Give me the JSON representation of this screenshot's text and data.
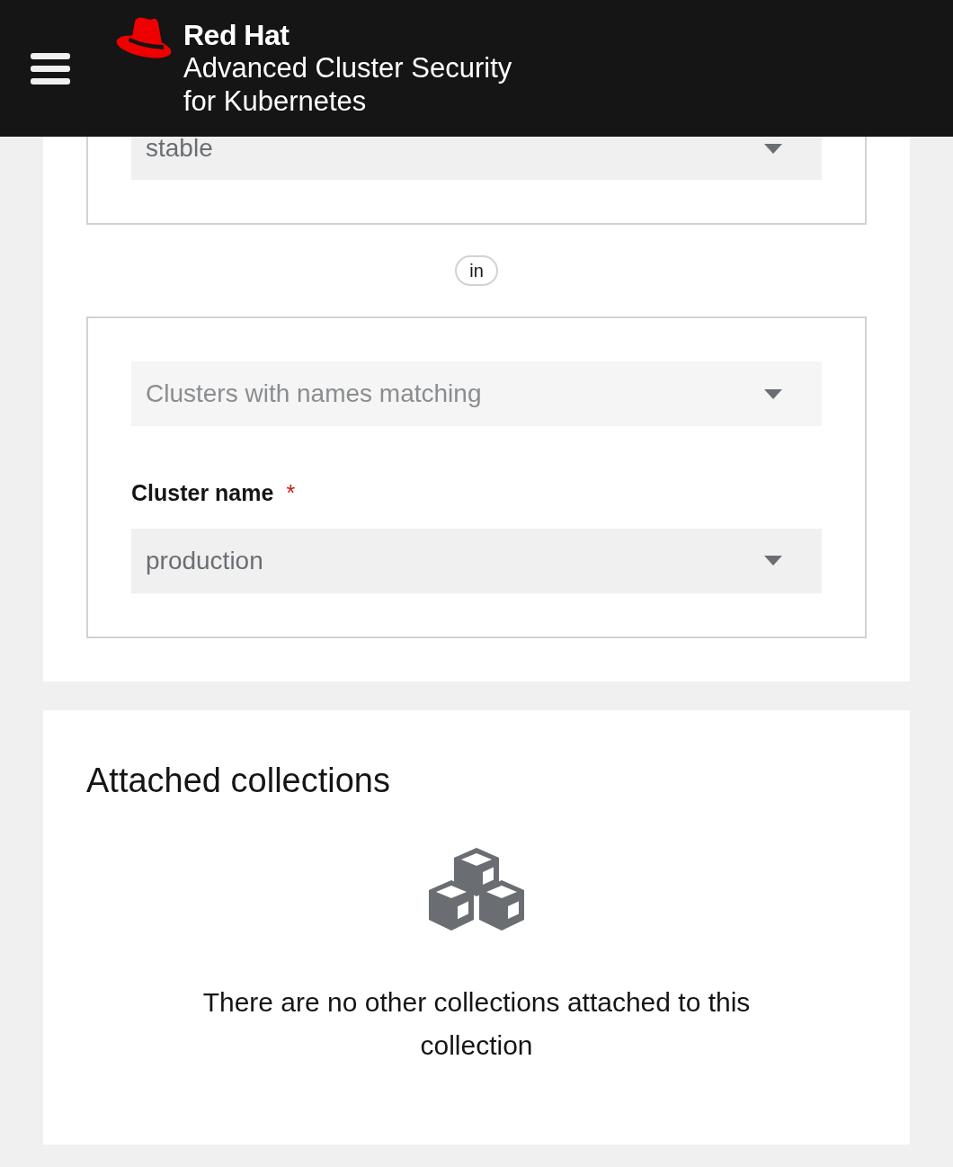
{
  "header": {
    "brand": "Red Hat",
    "product_line1": "Advanced Cluster Security",
    "product_line2": "for Kubernetes"
  },
  "rule_groups": [
    {
      "fields": [
        {
          "kind": "select",
          "value": "stable",
          "disabled": false
        }
      ]
    },
    {
      "fields": [
        {
          "kind": "select",
          "value": "Clusters with names matching",
          "disabled": true
        },
        {
          "kind": "label",
          "label": "Cluster name",
          "required_mark": "*"
        },
        {
          "kind": "select",
          "value": "production",
          "disabled": false
        }
      ]
    }
  ],
  "conjunction": "in",
  "attached_collections": {
    "title": "Attached collections",
    "empty_message": "There are no other collections attached to this collection"
  }
}
